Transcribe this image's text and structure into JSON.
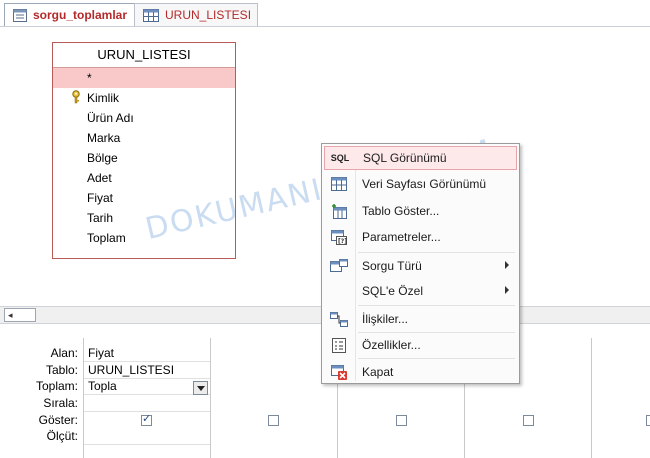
{
  "tabs": [
    {
      "label": "sorgu_toplamlar",
      "icon": "query-icon",
      "active": true
    },
    {
      "label": "URUN_LISTESI",
      "icon": "table-icon",
      "active": false
    }
  ],
  "table_box": {
    "title": "URUN_LISTESI",
    "fields": [
      {
        "label": "*",
        "selected": true
      },
      {
        "label": "Kimlik",
        "key": true
      },
      {
        "label": "Ürün Adı"
      },
      {
        "label": "Marka"
      },
      {
        "label": "Bölge"
      },
      {
        "label": "Adet"
      },
      {
        "label": "Fiyat"
      },
      {
        "label": "Tarih"
      },
      {
        "label": "Toplam"
      }
    ]
  },
  "context_menu": {
    "items": [
      {
        "label": "SQL Görünümü",
        "icon": "sql-icon",
        "icon_text": "SQL",
        "highlighted": true
      },
      {
        "label": "Veri Sayfası Görünümü",
        "icon": "datasheet-view-icon"
      },
      {
        "label": "Tablo Göster...",
        "icon": "show-table-icon"
      },
      {
        "label": "Parametreler...",
        "icon": "parameters-icon"
      },
      {
        "label": "Sorgu Türü",
        "icon": "query-type-icon",
        "submenu": true
      },
      {
        "label": "SQL'e Özel",
        "icon": "",
        "submenu": true
      },
      {
        "label": "İlişkiler...",
        "icon": "relationships-icon"
      },
      {
        "label": "Özellikler...",
        "icon": "properties-icon"
      },
      {
        "label": "Kapat",
        "icon": "close-icon"
      }
    ]
  },
  "grid": {
    "row_labels": {
      "field": "Alan:",
      "table": "Tablo:",
      "total": "Toplam:",
      "sort": "Sırala:",
      "show": "Göster:",
      "criteria": "Ölçüt:"
    },
    "columns": [
      {
        "field": "Fiyat",
        "table": "URUN_LISTESI",
        "total": "Topla",
        "show": true
      },
      {
        "field": "",
        "table": "",
        "total": "",
        "show": false
      },
      {
        "field": "",
        "table": "",
        "total": "",
        "show": false
      },
      {
        "field": "",
        "table": "",
        "total": "",
        "show": false
      },
      {
        "field": "",
        "table": "",
        "total": "",
        "show": false
      }
    ]
  },
  "watermark": "DOKUMANISTAN.COM"
}
